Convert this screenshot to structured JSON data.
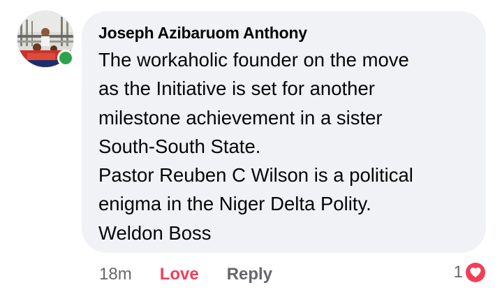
{
  "comment": {
    "author": "Joseph Azibaruom Anthony",
    "lines": [
      "The workaholic founder on the move",
      "as the Initiative is set for another",
      "milestone achievement in a sister",
      "South-South State.",
      "Pastor Reuben C Wilson is a political",
      "enigma in the Niger Delta Polity.",
      "Weldon Boss"
    ],
    "online": true
  },
  "actions": {
    "time": "18m",
    "love_label": "Love",
    "reply_label": "Reply"
  },
  "reactions": {
    "count": "1",
    "icon": "heart-icon"
  },
  "colors": {
    "bubble_bg": "#f0f2f5",
    "love": "#f33e58",
    "secondary_text": "#65676b",
    "online": "#31a24c"
  }
}
